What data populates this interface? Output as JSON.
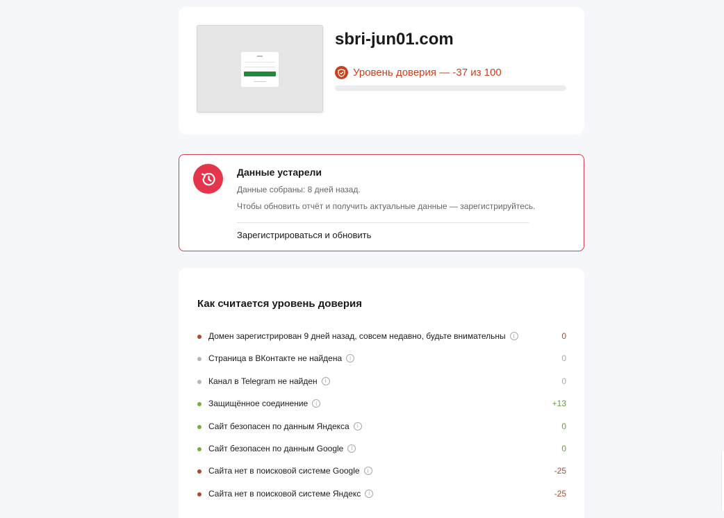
{
  "site": {
    "domain": "sbri-jun01.com",
    "trust_label": "Уровень доверия — -37 из 100",
    "trust_score": -37,
    "trust_max": 100,
    "trust_color": "#c8411c"
  },
  "outdated": {
    "title": "Данные устарели",
    "collected": "Данные собраны: 8 дней назад.",
    "hint": "Чтобы обновить отчёт и получить актуальные данные — зарегистрируйтесь.",
    "action": "Зарегистрироваться и обновить",
    "accent": "#e5354d"
  },
  "factors": {
    "title": "Как считается уровень доверия",
    "items": [
      {
        "label": "Домен зарегистрирован 9 дней назад, совсем недавно, будьте внимательны",
        "score": "0",
        "status": "red",
        "info_icon": "info-icon"
      },
      {
        "label": "Страница в ВКонтакте не найдена",
        "score": "0",
        "status": "gray",
        "info_icon": "info-icon"
      },
      {
        "label": "Канал в Telegram не найден",
        "score": "0",
        "status": "gray",
        "info_icon": "info-icon"
      },
      {
        "label": "Защищённое соединение",
        "score": "+13",
        "status": "green",
        "info_icon": "info-icon"
      },
      {
        "label": "Сайт безопасен по данным Яндекса",
        "score": "0",
        "status": "green",
        "info_icon": "info-icon"
      },
      {
        "label": "Сайт безопасен по данным Google",
        "score": "0",
        "status": "green",
        "info_icon": "info-icon"
      },
      {
        "label": "Сайта нет в поисковой системе Google",
        "score": "-25",
        "status": "red",
        "info_icon": "info-icon"
      },
      {
        "label": "Сайта нет в поисковой системе Яндекс",
        "score": "-25",
        "status": "red",
        "info_icon": "info-icon"
      }
    ]
  },
  "icons": {
    "shield": "shield-icon",
    "clock": "history-clock-icon",
    "info": "info-icon"
  }
}
